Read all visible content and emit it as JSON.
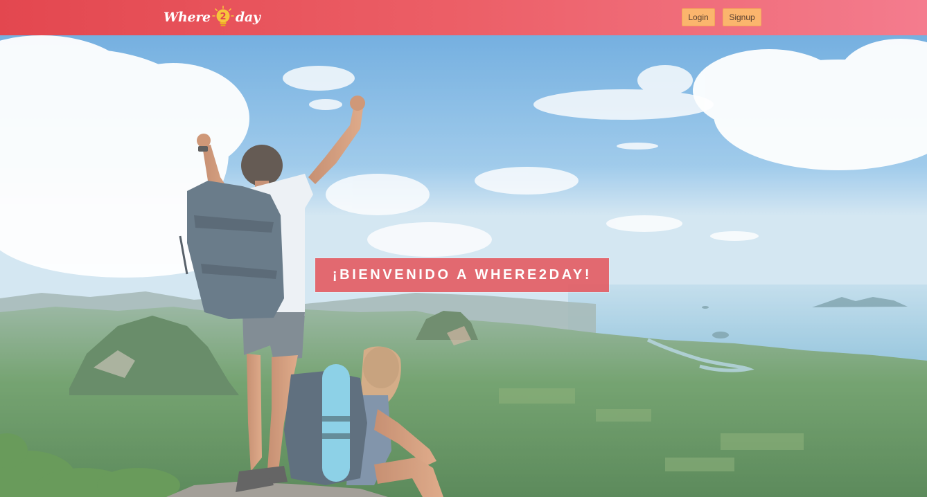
{
  "brand": {
    "word_left": "Where",
    "digit": "2",
    "word_right": "day",
    "icon": "lightbulb-icon"
  },
  "nav": {
    "login_label": "Login",
    "signup_label": "Signup"
  },
  "hero": {
    "welcome_text": "¡BIENVENIDO A WHERE2DAY!",
    "image": "hikers-on-mountain-overlooking-bay"
  },
  "colors": {
    "navbar_start": "#e3474f",
    "navbar_end": "#f47c8e",
    "button_bg": "#fbb56d",
    "banner_bg": "#e4585d"
  }
}
